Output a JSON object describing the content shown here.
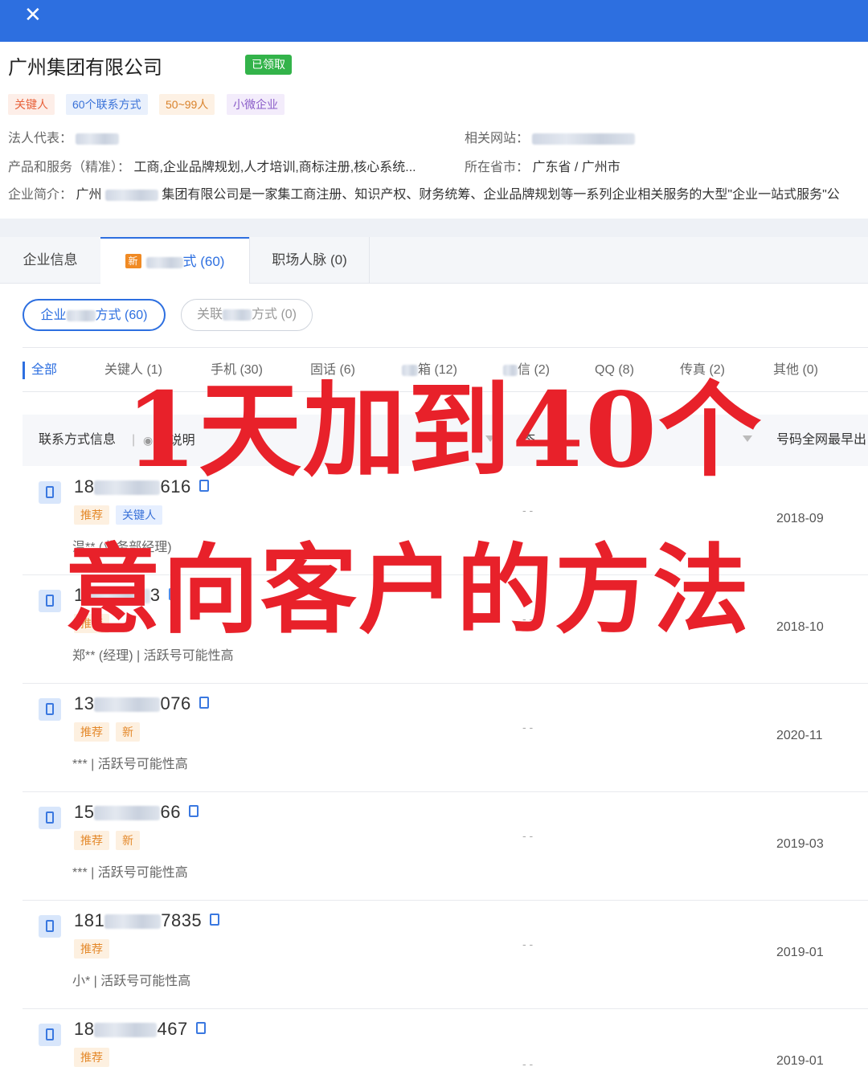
{
  "header": {
    "close_icon": "close-icon"
  },
  "company": {
    "title": "广州集团有限公司",
    "claimed": "已领取",
    "tags": [
      "关键人",
      "60个联系方式",
      "50~99人",
      "小微企业"
    ],
    "legal_rep_label": "法人代表：",
    "products_label": "产品和服务（精准）：",
    "products_value": "工商,企业品牌规划,人才培训,商标注册,核心系统...",
    "intro_label": "企业简介：",
    "intro_prefix": "广州",
    "intro_value": "集团有限公司是一家集工商注册、知识产权、财务统筹、企业品牌规划等一系列企业相关服务的大型\"企业一站式服务\"公",
    "website_label": "相关网站：",
    "region_label": "所在省市：",
    "region_value": "广东省 / 广州市"
  },
  "tabs": {
    "tab0": "企业信息",
    "tab1_icon": "新",
    "tab1": "式 (60)",
    "tab2": "职场人脉 (0)"
  },
  "pills": {
    "p0_prefix": "企业",
    "p0_suffix": "方式 (60)",
    "p1_prefix": "关联",
    "p1_suffix": "方式 (0)"
  },
  "filters": [
    "全部",
    "关键人 (1)",
    "手机 (30)",
    "固话 (6)",
    "箱 (12)",
    "信 (2)",
    "QQ (8)",
    "传真 (2)",
    "其他 (0)"
  ],
  "table": {
    "col_contact": "联系方式信息",
    "col_note": "记说明",
    "col_status": "态",
    "col_first": "号码全网最早出"
  },
  "rows": [
    {
      "num_prefix": "18",
      "num_suffix": "616",
      "tags": [
        "推荐",
        "关键人"
      ],
      "desc": "温** (业务部经理)",
      "dash": "- -",
      "date": "2018-09"
    },
    {
      "num_prefix": "1",
      "num_suffix": "3",
      "tags": [
        "推荐"
      ],
      "desc": "郑** (经理) | 活跃号可能性高",
      "dash": "- -",
      "date": "2018-10"
    },
    {
      "num_prefix": "13",
      "num_suffix": "076",
      "tags": [
        "推荐",
        "新"
      ],
      "desc": "*** | 活跃号可能性高",
      "dash": "- -",
      "date": "2020-11"
    },
    {
      "num_prefix": "15",
      "num_suffix": "66",
      "tags": [
        "推荐",
        "新"
      ],
      "desc": "*** | 活跃号可能性高",
      "dash": "- -",
      "date": "2019-03"
    },
    {
      "num_prefix": "181",
      "num_suffix": "7835",
      "tags": [
        "推荐"
      ],
      "desc": "小* | 活跃号可能性高",
      "dash": "- -",
      "date": "2019-01"
    },
    {
      "num_prefix": "18",
      "num_suffix": "467",
      "tags": [
        "推荐"
      ],
      "desc": "",
      "dash": "- -",
      "date": "2019-01"
    }
  ],
  "overlay": {
    "line1": "1天加到40个",
    "line2": "意向客户的方法"
  }
}
